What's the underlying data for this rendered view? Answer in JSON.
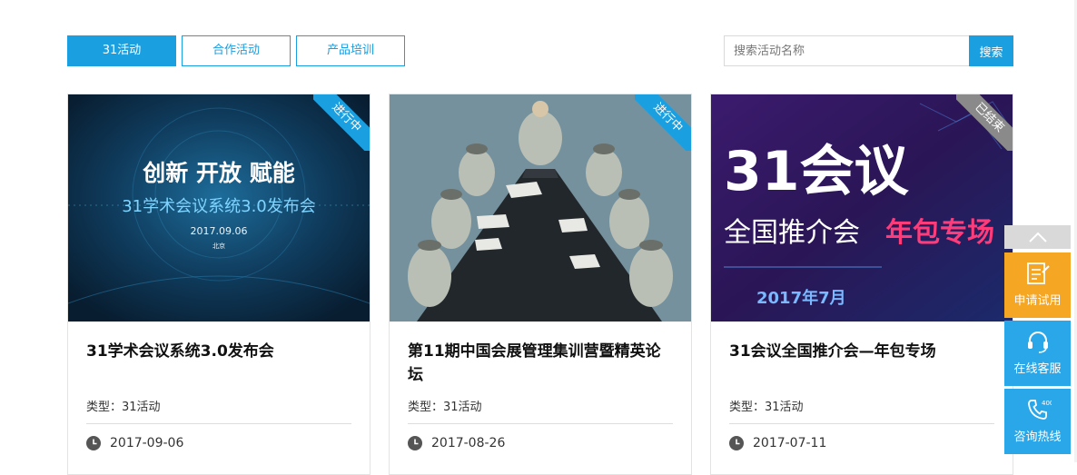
{
  "tabs": [
    {
      "label": "31活动",
      "active": true
    },
    {
      "label": "合作活动",
      "active": false
    },
    {
      "label": "产品培训",
      "active": false
    }
  ],
  "search": {
    "placeholder": "搜索活动名称",
    "button_label": "搜索"
  },
  "cards": [
    {
      "status": "进行中",
      "banner": {
        "headline": "创新  开放  赋能",
        "subtitle": "31学术会议系统3.0发布会",
        "date": "2017.09.06",
        "location": "北京"
      },
      "title": "31学术会议系统3.0发布会",
      "type": "类型：31活动",
      "date": "2017-09-06"
    },
    {
      "status": "进行中",
      "title": "第11期中国会展管理集训营暨精英论坛",
      "type": "类型：31活动",
      "date": "2017-08-26"
    },
    {
      "status": "已结束",
      "banner": {
        "headline": "31会议",
        "line2a": "全国推介会",
        "line2b": "年包专场",
        "date": "2017年7月"
      },
      "title": "31会议全国推介会—年包专场",
      "type": "类型：31活动",
      "date": "2017-07-11"
    }
  ],
  "side": {
    "items": [
      {
        "label": "申请试用",
        "icon": "edit-doc-icon"
      },
      {
        "label": "在线客服",
        "icon": "headset-icon"
      },
      {
        "label": "咨询热线",
        "icon": "phone-400-icon"
      }
    ]
  },
  "colors": {
    "accent": "#1a9fe0",
    "trial": "#f5a623",
    "ended": "#8a8a8a"
  }
}
